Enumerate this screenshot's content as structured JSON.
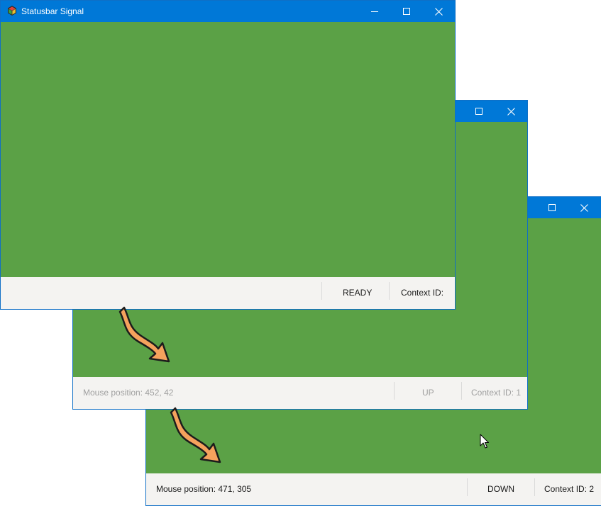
{
  "window_top": {
    "title": "Statusbar Signal",
    "status": {
      "mouse_position": "",
      "state": "READY",
      "context": "Context ID:"
    }
  },
  "window_middle": {
    "status": {
      "mouse_position": "Mouse position: 452, 42",
      "state": "UP",
      "context": "Context ID: 1"
    }
  },
  "window_bottom": {
    "status": {
      "mouse_position": "Mouse position: 471, 305",
      "state": "DOWN",
      "context": "Context ID: 2"
    }
  },
  "colors": {
    "titlebar": "#0078d7",
    "client": "#5ba146",
    "statusbar": "#f4f3f1",
    "arrow": "#f5a25d"
  },
  "icons": [
    "app-icon",
    "minimize-icon",
    "maximize-icon",
    "close-icon",
    "arrow-icon",
    "mouse-cursor-icon"
  ]
}
